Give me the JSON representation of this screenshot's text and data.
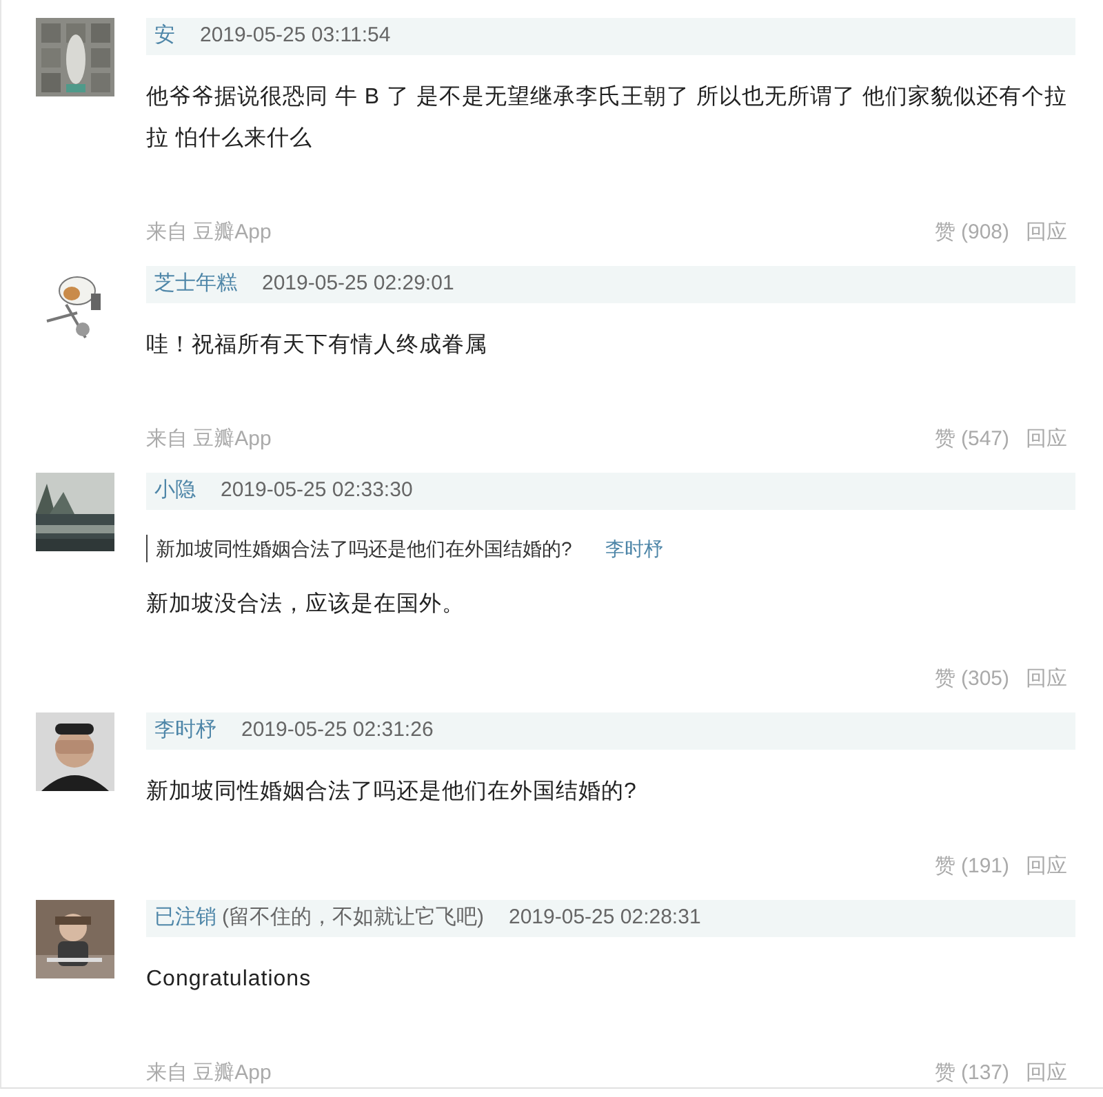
{
  "comments": [
    {
      "user": "安",
      "time": "2019-05-25 03:11:54",
      "text": "他爷爷据说很恐同 牛 B 了 是不是无望继承李氏王朝了 所以也无所谓了 他们家貌似还有个拉拉 怕什么来什么",
      "source": "来自 豆瓣App",
      "likes": "赞 (908)",
      "reply": "回应"
    },
    {
      "user": "芝士年糕",
      "time": "2019-05-25 02:29:01",
      "text": "哇！祝福所有天下有情人终成眷属",
      "source": "来自 豆瓣App",
      "likes": "赞 (547)",
      "reply": "回应"
    },
    {
      "user": "小隐",
      "time": "2019-05-25 02:33:30",
      "quote": {
        "text": "新加坡同性婚姻合法了吗还是他们在外国结婚的?",
        "author": "李时杼"
      },
      "text": "新加坡没合法，应该是在国外。",
      "likes": "赞 (305)",
      "reply": "回应"
    },
    {
      "user": "李时杼",
      "time": "2019-05-25 02:31:26",
      "text": "新加坡同性婚姻合法了吗还是他们在外国结婚的?",
      "likes": "赞 (191)",
      "reply": "回应"
    },
    {
      "user": "已注销",
      "user_note": "(留不住的，不如就让它飞吧)",
      "time": "2019-05-25 02:28:31",
      "text": "Congratulations",
      "source": "来自 豆瓣App",
      "likes": "赞 (137)",
      "reply": "回应"
    }
  ]
}
